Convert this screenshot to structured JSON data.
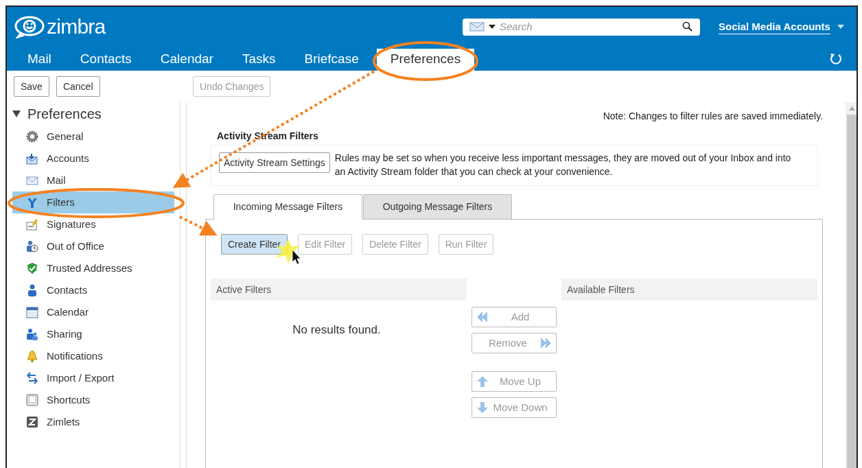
{
  "app": {
    "logo": "zimbra"
  },
  "search": {
    "placeholder": "Search"
  },
  "account": {
    "label": "Social Media Accounts"
  },
  "tabs": [
    {
      "label": "Mail",
      "selected": false
    },
    {
      "label": "Contacts",
      "selected": false
    },
    {
      "label": "Calendar",
      "selected": false
    },
    {
      "label": "Tasks",
      "selected": false
    },
    {
      "label": "Briefcase",
      "selected": false
    },
    {
      "label": "Preferences",
      "selected": true
    }
  ],
  "toolbar": [
    {
      "label": "Save",
      "disabled": false
    },
    {
      "label": "Cancel",
      "disabled": false
    },
    {
      "label": "Undo Changes",
      "disabled": true
    }
  ],
  "sidebar": {
    "title": "Preferences",
    "expanded": true,
    "items": [
      {
        "label": "General",
        "selected": false
      },
      {
        "label": "Accounts",
        "selected": false
      },
      {
        "label": "Mail",
        "selected": false
      },
      {
        "label": "Filters",
        "selected": true
      },
      {
        "label": "Signatures",
        "selected": false
      },
      {
        "label": "Out of Office",
        "selected": false
      },
      {
        "label": "Trusted Addresses",
        "selected": false
      },
      {
        "label": "Contacts",
        "selected": false
      },
      {
        "label": "Calendar",
        "selected": false
      },
      {
        "label": "Sharing",
        "selected": false
      },
      {
        "label": "Notifications",
        "selected": false
      },
      {
        "label": "Import / Export",
        "selected": false
      },
      {
        "label": "Shortcuts",
        "selected": false
      },
      {
        "label": "Zimlets",
        "selected": false
      }
    ]
  },
  "note": "Note: Changes to filter rules are saved immediately.",
  "activity_stream": {
    "title": "Activity Stream Filters",
    "button": "Activity Stream Settings",
    "description": "Rules may be set so when you receive less important messages, they are moved out of your Inbox and into an Activity Stream folder that you can check at your convenience."
  },
  "filter_tabs": [
    {
      "label": "Incoming Message Filters",
      "selected": true
    },
    {
      "label": "Outgoing Message Filters",
      "selected": false
    }
  ],
  "filter_actions": [
    {
      "label": "Create Filter",
      "disabled": false,
      "highlighted": true
    },
    {
      "label": "Edit Filter",
      "disabled": true,
      "highlighted": false
    },
    {
      "label": "Delete Filter",
      "disabled": true,
      "highlighted": false
    },
    {
      "label": "Run Filter",
      "disabled": true,
      "highlighted": false
    }
  ],
  "active_filters": {
    "title": "Active Filters",
    "empty_text": "No results found."
  },
  "available_filters": {
    "title": "Available Filters"
  },
  "move_buttons": [
    {
      "label": "Add",
      "disabled": true
    },
    {
      "label": "Remove",
      "disabled": true
    },
    {
      "label": "Move Up",
      "disabled": true
    },
    {
      "label": "Move Down",
      "disabled": true
    }
  ]
}
